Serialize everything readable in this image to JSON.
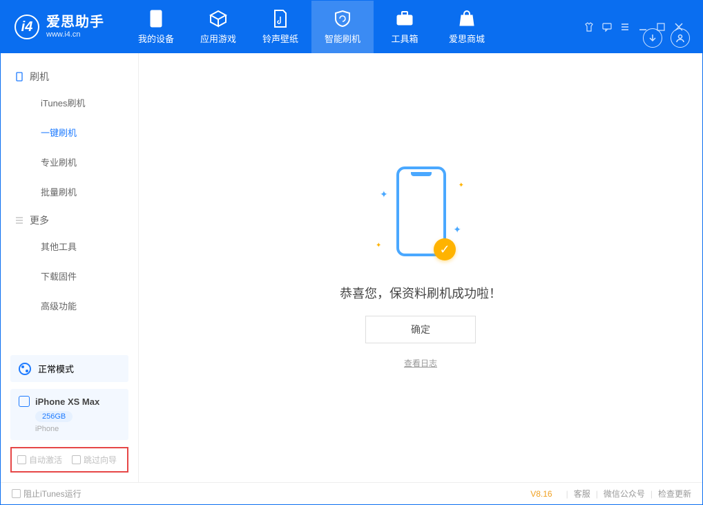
{
  "app": {
    "name": "爱思助手",
    "domain": "www.i4.cn"
  },
  "tabs": [
    {
      "id": "device",
      "label": "我的设备"
    },
    {
      "id": "apps",
      "label": "应用游戏"
    },
    {
      "id": "media",
      "label": "铃声壁纸"
    },
    {
      "id": "flash",
      "label": "智能刷机",
      "active": true
    },
    {
      "id": "tools",
      "label": "工具箱"
    },
    {
      "id": "store",
      "label": "爱思商城"
    }
  ],
  "sidebar": {
    "group1": {
      "label": "刷机",
      "items": [
        {
          "id": "itunes",
          "label": "iTunes刷机"
        },
        {
          "id": "onekey",
          "label": "一键刷机",
          "active": true
        },
        {
          "id": "pro",
          "label": "专业刷机"
        },
        {
          "id": "batch",
          "label": "批量刷机"
        }
      ]
    },
    "group2": {
      "label": "更多",
      "items": [
        {
          "id": "other",
          "label": "其他工具"
        },
        {
          "id": "firmware",
          "label": "下载固件"
        },
        {
          "id": "adv",
          "label": "高级功能"
        }
      ]
    },
    "mode": {
      "label": "正常模式"
    },
    "device": {
      "name": "iPhone XS Max",
      "capacity": "256GB",
      "type": "iPhone"
    },
    "checks": {
      "auto_activate": "自动激活",
      "skip_guide": "跳过向导"
    }
  },
  "result": {
    "message": "恭喜您，保资料刷机成功啦！",
    "confirm": "确定",
    "view_log": "查看日志"
  },
  "statusbar": {
    "block_itunes": "阻止iTunes运行",
    "version": "V8.16",
    "links": [
      "客服",
      "微信公众号",
      "检查更新"
    ]
  }
}
